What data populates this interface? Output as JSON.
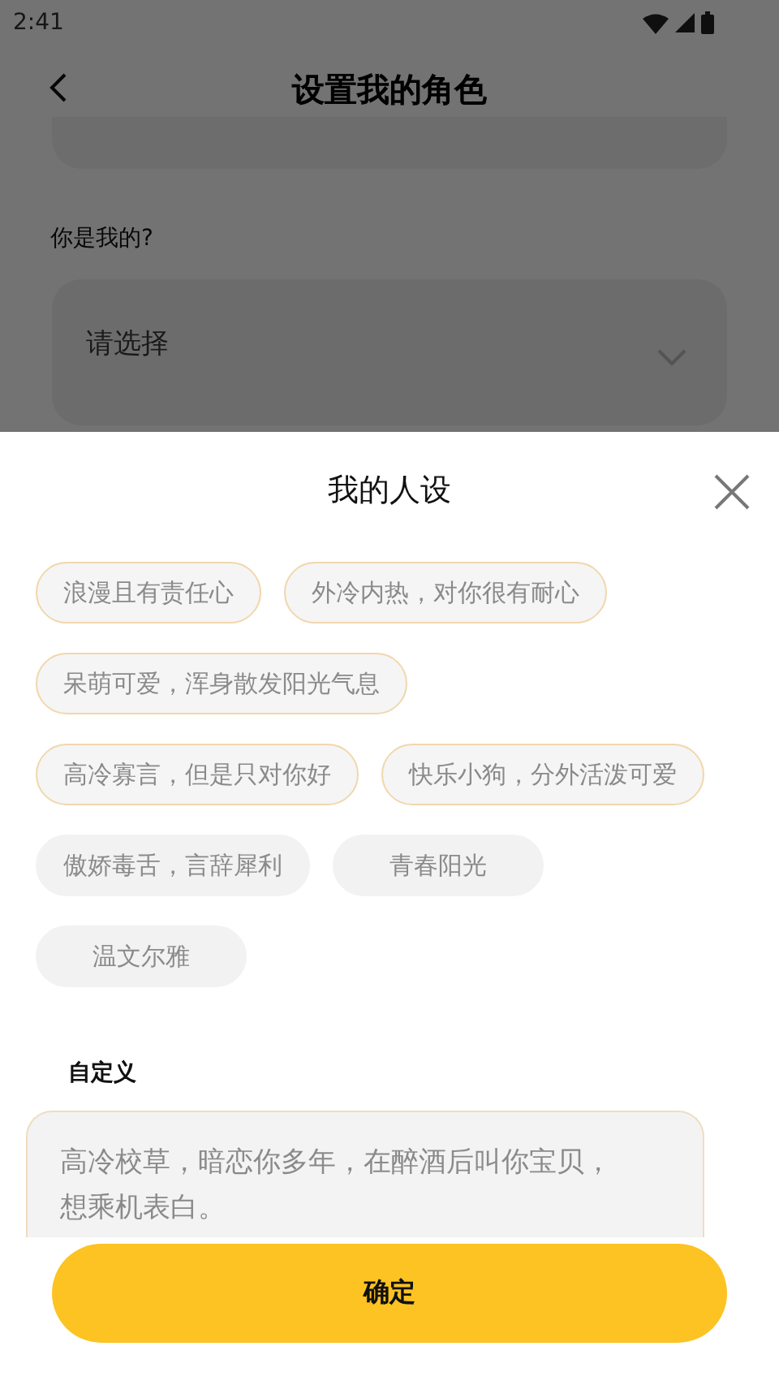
{
  "status_bar": {
    "time": "2:41"
  },
  "header": {
    "title": "设置我的角色"
  },
  "form": {
    "question_label": "你是我的?",
    "select": {
      "placeholder": "请选择"
    }
  },
  "sheet": {
    "title": "我的人设",
    "tags": [
      {
        "label": "浪漫且有责任心",
        "selected": true
      },
      {
        "label": "外冷内热，对你很有耐心",
        "selected": true
      },
      {
        "label": "呆萌可爱，浑身散发阳光气息",
        "selected": true
      },
      {
        "label": "高冷寡言，但是只对你好",
        "selected": true
      },
      {
        "label": "快乐小狗，分外活泼可爱",
        "selected": true
      },
      {
        "label": "傲娇毒舌，言辞犀利",
        "selected": false
      },
      {
        "label": "青春阳光",
        "selected": false
      },
      {
        "label": "温文尔雅",
        "selected": false
      }
    ],
    "custom_label": "自定义",
    "custom_value": "高冷校草，暗恋你多年，在醉酒后叫你宝贝，想乘机表白。",
    "confirm_button": "确定"
  }
}
